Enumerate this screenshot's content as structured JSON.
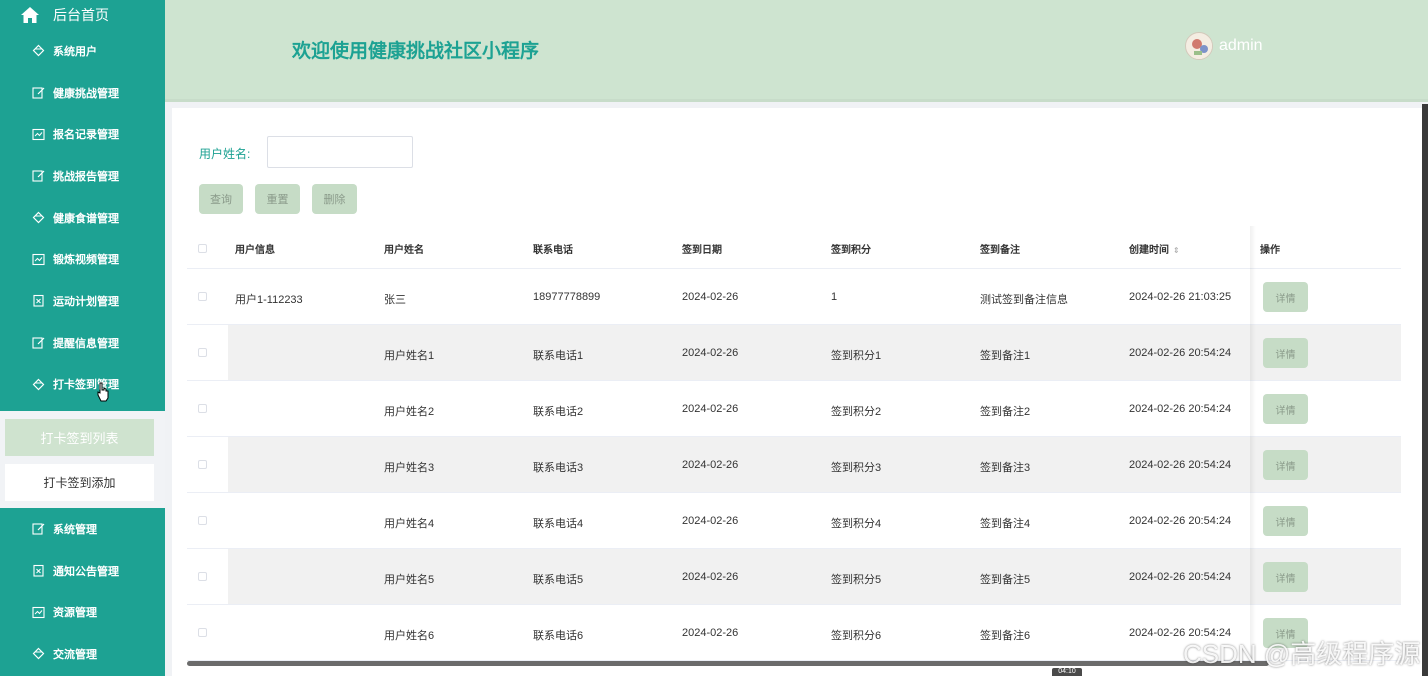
{
  "sidebar": {
    "home": "后台首页",
    "items_upper": [
      {
        "label": "系统用户",
        "icon": "diamond-icon"
      },
      {
        "label": "健康挑战管理",
        "icon": "edit-icon"
      },
      {
        "label": "报名记录管理",
        "icon": "chart-icon"
      },
      {
        "label": "挑战报告管理",
        "icon": "edit-icon"
      },
      {
        "label": "健康食谱管理",
        "icon": "diamond-icon"
      },
      {
        "label": "锻炼视频管理",
        "icon": "chart-icon"
      },
      {
        "label": "运动计划管理",
        "icon": "clipboard-icon"
      },
      {
        "label": "提醒信息管理",
        "icon": "edit-icon"
      },
      {
        "label": "打卡签到管理",
        "icon": "diamond-icon"
      }
    ],
    "submenu": {
      "active": "打卡签到列表",
      "normal": "打卡签到添加"
    },
    "items_lower": [
      {
        "label": "系统管理",
        "icon": "edit-icon"
      },
      {
        "label": "通知公告管理",
        "icon": "clipboard-icon"
      },
      {
        "label": "资源管理",
        "icon": "chart-icon"
      },
      {
        "label": "交流管理",
        "icon": "diamond-icon"
      }
    ]
  },
  "header": {
    "title": "欢迎使用健康挑战社区小程序",
    "user": "admin"
  },
  "search": {
    "label": "用户姓名:",
    "value": ""
  },
  "buttons": {
    "query": "查询",
    "reset": "重置",
    "delete": "删除"
  },
  "table": {
    "columns": [
      "用户信息",
      "用户姓名",
      "联系电话",
      "签到日期",
      "签到积分",
      "签到备注",
      "创建时间",
      "操作"
    ],
    "sort_indicator": "⇕",
    "detail_label": "详情",
    "rows": [
      {
        "info": "用户1-112233",
        "name": "张三",
        "phone": "18977778899",
        "date": "2024-02-26",
        "points": "1",
        "note": "测试签到备注信息",
        "created": "2024-02-26 21:03:25"
      },
      {
        "info": "",
        "name": "用户姓名1",
        "phone": "联系电话1",
        "date": "2024-02-26",
        "points": "签到积分1",
        "note": "签到备注1",
        "created": "2024-02-26 20:54:24"
      },
      {
        "info": "",
        "name": "用户姓名2",
        "phone": "联系电话2",
        "date": "2024-02-26",
        "points": "签到积分2",
        "note": "签到备注2",
        "created": "2024-02-26 20:54:24"
      },
      {
        "info": "",
        "name": "用户姓名3",
        "phone": "联系电话3",
        "date": "2024-02-26",
        "points": "签到积分3",
        "note": "签到备注3",
        "created": "2024-02-26 20:54:24"
      },
      {
        "info": "",
        "name": "用户姓名4",
        "phone": "联系电话4",
        "date": "2024-02-26",
        "points": "签到积分4",
        "note": "签到备注4",
        "created": "2024-02-26 20:54:24"
      },
      {
        "info": "",
        "name": "用户姓名5",
        "phone": "联系电话5",
        "date": "2024-02-26",
        "points": "签到积分5",
        "note": "签到备注5",
        "created": "2024-02-26 20:54:24"
      },
      {
        "info": "",
        "name": "用户姓名6",
        "phone": "联系电话6",
        "date": "2024-02-26",
        "points": "签到积分6",
        "note": "签到备注6",
        "created": "2024-02-26 20:54:24"
      }
    ]
  },
  "watermark": "CSDN @高级程序源",
  "time_badge": "04:10",
  "colors": {
    "sidebar": "#1da293",
    "header": "#cee4d0",
    "accent": "#1da293",
    "button": "#c6dcc6"
  }
}
